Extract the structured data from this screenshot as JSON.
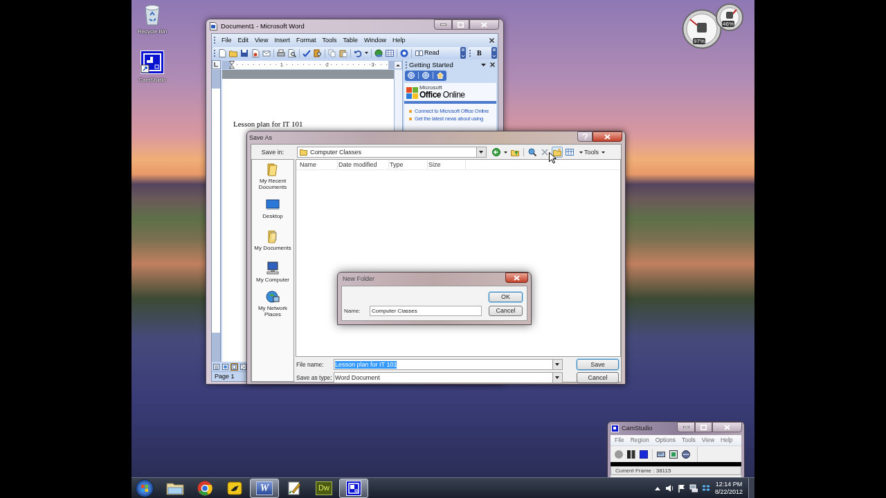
{
  "desktop_icons": [
    {
      "kind": "recycle-bin",
      "label": "Recycle Bin"
    },
    {
      "kind": "camstudio",
      "label": "CamStudio"
    }
  ],
  "gadget": {
    "readings": [
      "97%",
      "46%"
    ]
  },
  "word": {
    "title": "Document1 - Microsoft Word",
    "menu": [
      "File",
      "Edit",
      "View",
      "Insert",
      "Format",
      "Tools",
      "Table",
      "Window",
      "Help"
    ],
    "read_button": "Read",
    "bold_button": "B",
    "ruler_numbers": [
      "1",
      "2",
      "3"
    ],
    "document_text": "Lesson plan for IT 101",
    "task_pane": {
      "title": "Getting Started",
      "logo_small": "Microsoft",
      "logo": "**Office** Online",
      "links": [
        "Connect to Microsoft Office Online",
        "Get the latest news about using"
      ]
    },
    "view_buttons": [
      {
        "kind": "normal",
        "selected": false
      },
      {
        "kind": "web",
        "selected": false
      },
      {
        "kind": "print",
        "selected": true
      },
      {
        "kind": "outline",
        "selected": false
      }
    ],
    "status": "Page 1"
  },
  "save_as": {
    "title": "Save As",
    "save_in_label": "Save in:",
    "save_in": "Computer Classes",
    "toolbar": [
      {
        "kind": "back",
        "hovered": false
      },
      {
        "kind": "up-folder",
        "hovered": false
      },
      {
        "kind": "search-web",
        "hovered": false
      },
      {
        "kind": "delete",
        "hovered": false
      },
      {
        "kind": "new-folder",
        "hovered": true
      },
      {
        "kind": "views",
        "hovered": false
      }
    ],
    "tools_label": "Tools",
    "places": [
      {
        "kind": "recent",
        "label": "My Recent Documents"
      },
      {
        "kind": "desktop",
        "label": "Desktop"
      },
      {
        "kind": "documents",
        "label": "My Documents"
      },
      {
        "kind": "computer",
        "label": "My Computer"
      },
      {
        "kind": "network",
        "label": "My Network Places"
      }
    ],
    "columns": [
      "Name",
      "Date modified",
      "Type",
      "Size"
    ],
    "fields": [
      {
        "label": "File name:",
        "value": "Lesson plan for IT 101",
        "selected": true
      },
      {
        "label": "Save as type:",
        "value": "Word Document",
        "selected": false
      }
    ],
    "buttons": [
      {
        "label": "Save",
        "default": true
      },
      {
        "label": "Cancel",
        "default": false
      }
    ]
  },
  "new_folder": {
    "title": "New Folder",
    "name_label": "Name:",
    "name_value": "Computer Classes",
    "buttons": [
      {
        "label": "OK",
        "default": true
      },
      {
        "label": "Cancel",
        "default": false
      }
    ]
  },
  "camstudio": {
    "title": "CamStudio",
    "menu": [
      "File",
      "Region",
      "Options",
      "Tools",
      "View",
      "Help"
    ],
    "status": "Current Frame : 38115"
  },
  "taskbar": {
    "apps": [
      {
        "kind": "explorer",
        "active": false
      },
      {
        "kind": "chrome",
        "active": false
      },
      {
        "kind": "bird",
        "active": false
      },
      {
        "kind": "word",
        "label": "W",
        "active": true
      },
      {
        "kind": "pen",
        "active": false
      },
      {
        "kind": "dreamweaver",
        "label": "Dw",
        "active": false
      },
      {
        "kind": "camstudio",
        "active": true
      }
    ],
    "clock": {
      "time": "12:14 PM",
      "date": "8/22/2012"
    }
  }
}
